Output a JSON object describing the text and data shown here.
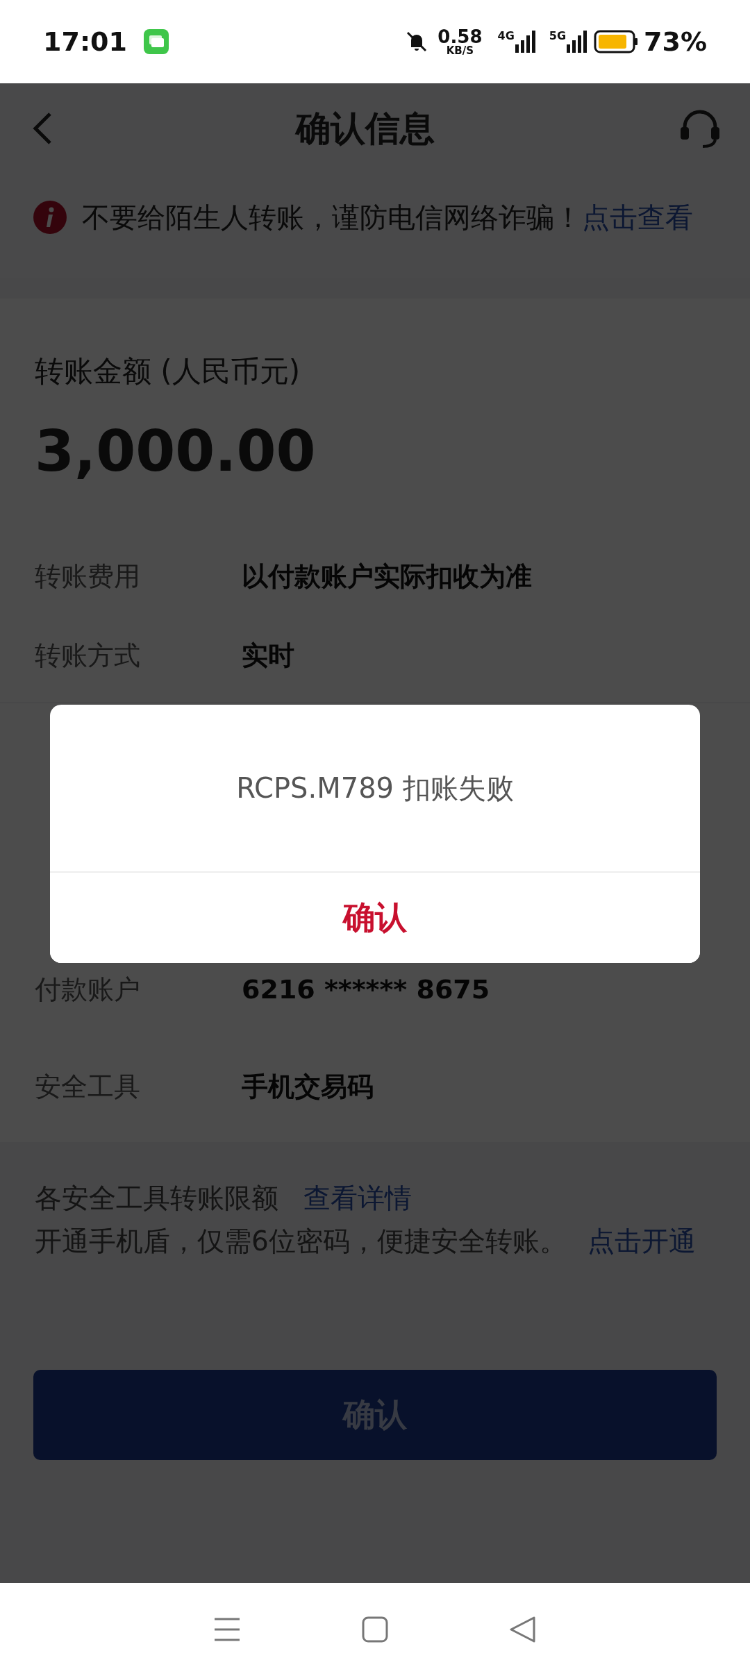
{
  "status_bar": {
    "time": "17:01",
    "net_speed": "0.58",
    "net_speed_unit": "KB/S",
    "sim1": "4G",
    "sim2": "5G",
    "battery": "73%"
  },
  "header": {
    "title": "确认信息"
  },
  "warning": {
    "text": "不要给陌生人转账，谨防电信网络诈骗！",
    "link": "点击查看"
  },
  "amount": {
    "label": "转账金额 (人民币元)",
    "value": "3,000.00"
  },
  "details": [
    {
      "label": "转账费用",
      "value": "以付款账户实际扣收为准"
    },
    {
      "label": "转账方式",
      "value": "实时"
    }
  ],
  "accounts": [
    {
      "label": "付款账户",
      "value": "6216 ****** 8675"
    },
    {
      "label": "安全工具",
      "value": "手机交易码"
    }
  ],
  "limits": {
    "text": "各安全工具转账限额",
    "link": "查看详情"
  },
  "shield": {
    "text": "开通手机盾，仅需6位密码，便捷安全转账。",
    "link": "点击开通"
  },
  "confirm_button": "确认",
  "dialog": {
    "message": "RCPS.M789 扣账失败",
    "button": "确认"
  }
}
